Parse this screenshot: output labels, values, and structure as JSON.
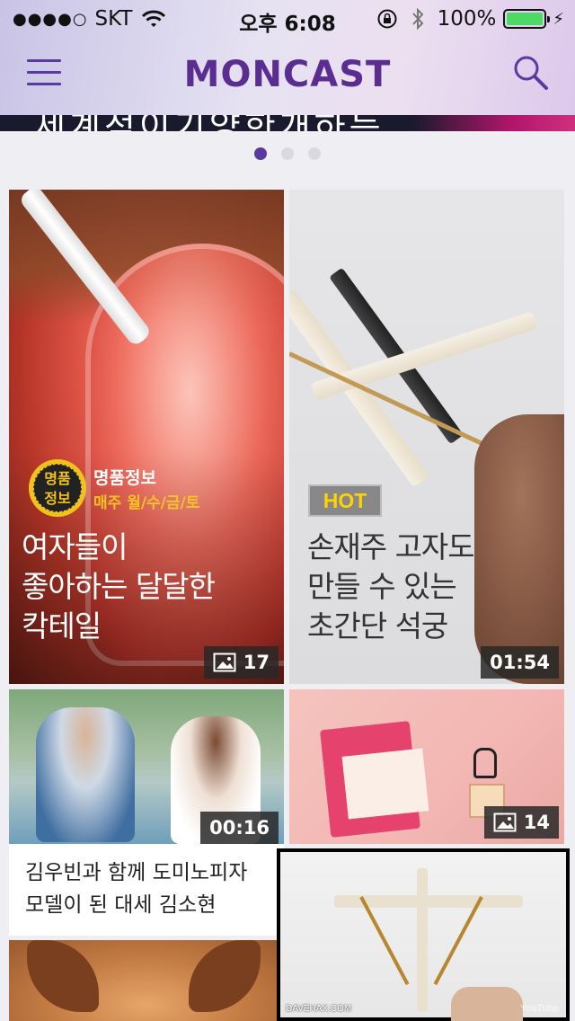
{
  "status_bar": {
    "signal_dots": "●●●●○",
    "carrier": "SKT",
    "time": "오후 6:08",
    "battery": "100%",
    "battery_level": 1.0
  },
  "nav": {
    "logo": "MONCAST",
    "accent_color": "#5b2d91"
  },
  "banner": {
    "text": "세계적이기양한개하는"
  },
  "pager": {
    "pages": 3,
    "active": 0
  },
  "cards": [
    {
      "badge_icon_text": "명품정보",
      "badge_title": "명품정보",
      "badge_subtitle": "매주 월/수/금/토",
      "title_lines": [
        "여자들이",
        "좋아하는 달달한",
        "칵테일"
      ],
      "meta_type": "image-count",
      "meta": "17"
    },
    {
      "tag": "HOT",
      "title_lines": [
        "손재주 고자도",
        "만들 수 있는",
        "초간단 석궁"
      ],
      "meta_type": "duration",
      "meta": "01:54"
    },
    {
      "caption_lines": [
        "김우빈과 함께 도미노피자",
        "모델이 된 대세 김소현"
      ],
      "meta_type": "duration",
      "meta": "00:16"
    },
    {
      "meta_type": "image-count",
      "meta": "14"
    }
  ],
  "pip": {
    "watermark": "DAVEHAX.COM",
    "logo": "YouTube"
  }
}
